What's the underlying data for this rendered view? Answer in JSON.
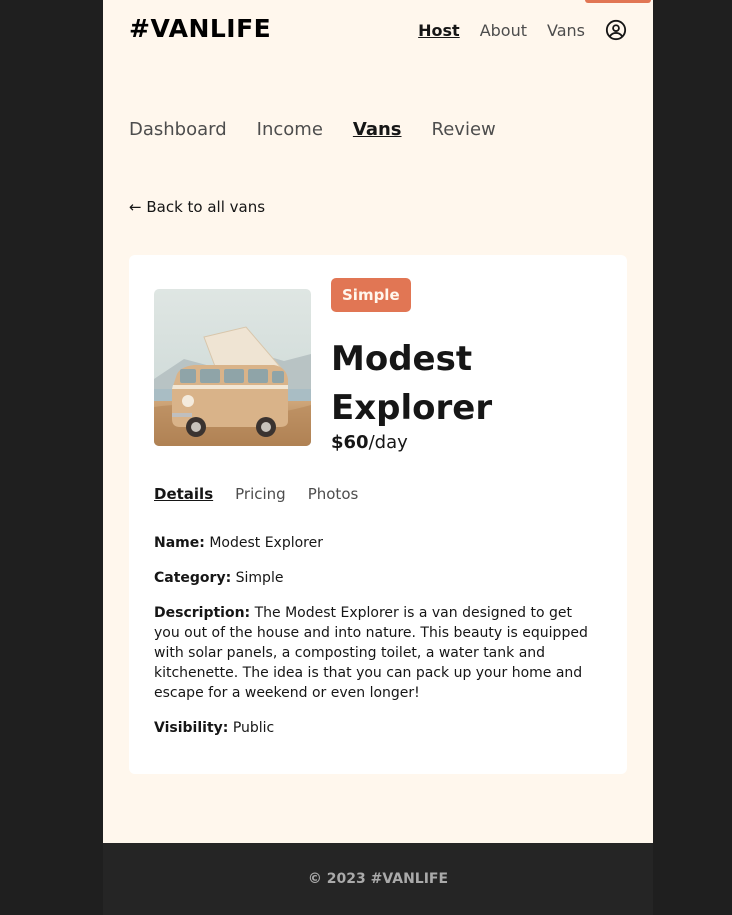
{
  "header": {
    "logo": "#VANLIFE",
    "nav": [
      {
        "label": "Host",
        "active": true
      },
      {
        "label": "About",
        "active": false
      },
      {
        "label": "Vans",
        "active": false
      }
    ],
    "user_icon": "user-circle-icon"
  },
  "host_nav": [
    {
      "label": "Dashboard"
    },
    {
      "label": "Income"
    },
    {
      "label": "Vans"
    },
    {
      "label": "Review"
    }
  ],
  "back_link": "← Back to all vans",
  "van": {
    "type": "Simple",
    "name": "Modest Explorer",
    "price_amount": "$60",
    "price_unit": "/day",
    "image": "van-photo-beige-camper"
  },
  "detail_tabs": [
    {
      "label": "Details"
    },
    {
      "label": "Pricing"
    },
    {
      "label": "Photos"
    }
  ],
  "details": {
    "name_label": "Name:",
    "name_value": "Modest Explorer",
    "category_label": "Category:",
    "category_value": "Simple",
    "description_label": "Description:",
    "description_value": "The Modest Explorer is a van designed to get you out of the house and into nature. This beauty is equipped with solar panels, a composting toilet, a water tank and kitchenette. The idea is that you can pack up your home and escape for a weekend or even longer!",
    "visibility_label": "Visibility:",
    "visibility_value": "Public"
  },
  "footer": {
    "text": "© 2023 #VANLIFE"
  },
  "colors": {
    "page_bg": "#fff7ed",
    "accent": "#e17654",
    "outer_bg": "#1f1f1f",
    "footer_bg": "#252525"
  }
}
